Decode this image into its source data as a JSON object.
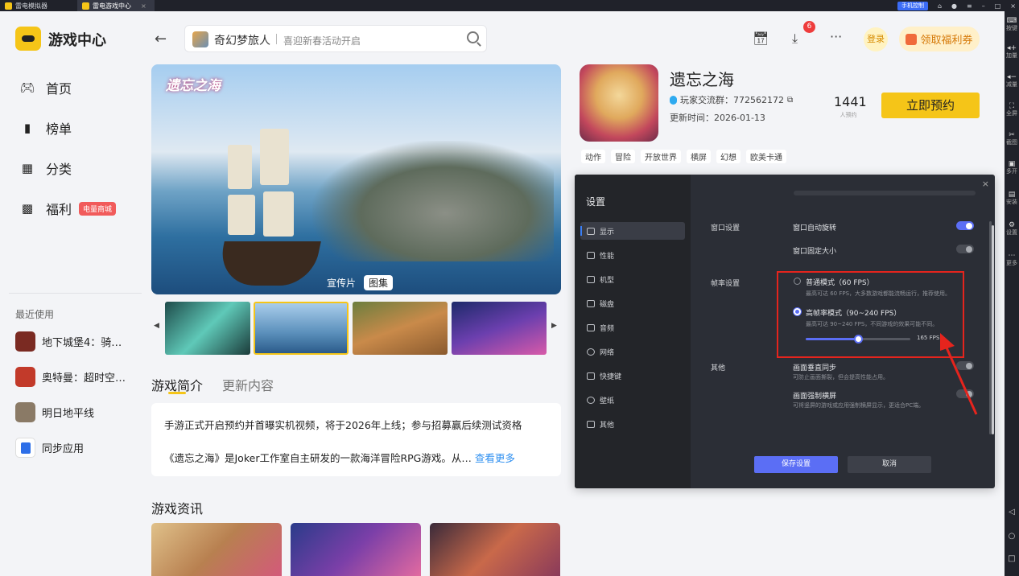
{
  "titlebar": {
    "tabs": [
      {
        "label": "雷电模拟器"
      },
      {
        "label": "雷电游戏中心"
      }
    ],
    "close_tab": "×",
    "phone_control": "手机控制",
    "window_buttons": {
      "minimize": "–",
      "maximize": "□",
      "close": "×"
    }
  },
  "right_strip": {
    "items": [
      {
        "label": "按键",
        "icon": "keyboard-icon"
      },
      {
        "label": "加量",
        "icon": "volume-up-icon"
      },
      {
        "label": "减量",
        "icon": "volume-down-icon"
      },
      {
        "label": "全屏",
        "icon": "fullscreen-icon"
      },
      {
        "label": "截图",
        "icon": "scissors-icon"
      },
      {
        "label": "多开",
        "icon": "multi-instance-icon"
      },
      {
        "label": "安装",
        "icon": "install-icon"
      },
      {
        "label": "设置",
        "icon": "gear-icon"
      },
      {
        "label": "更多",
        "icon": "more-icon"
      }
    ]
  },
  "sidebar": {
    "title": "游戏中心",
    "nav": [
      {
        "label": "首页",
        "icon": "gamepad-icon"
      },
      {
        "label": "榜单",
        "icon": "bar-chart-icon"
      },
      {
        "label": "分类",
        "icon": "grid-icon"
      },
      {
        "label": "福利",
        "icon": "gift-icon",
        "badge": "电量商城"
      }
    ],
    "recent_title": "最近使用",
    "recent": [
      {
        "label": "地下城堡4：骑…",
        "color": "#7a2a22"
      },
      {
        "label": "奥特曼：超时空…",
        "color": "#c23a2a"
      },
      {
        "label": "明日地平线",
        "color": "#8a7a66"
      },
      {
        "label": "同步应用",
        "color": "#2e6fe8"
      }
    ]
  },
  "header": {
    "search": {
      "keyword": "奇幻梦旅人",
      "placeholder": "喜迎新春活动开启"
    },
    "download_badge": "6",
    "more": "···",
    "login": "登录",
    "welfare": "领取福利券"
  },
  "banner": {
    "logo_text": "遗忘之海",
    "tabs": [
      "宣传片",
      "图集"
    ]
  },
  "content": {
    "tabs": [
      "游戏简介",
      "更新内容"
    ],
    "intro_line1": "手游正式开启预约并首曝实机视频，将于2026年上线；参与招募赢后续测试资格",
    "intro_line2": "《遗忘之海》是Joker工作室自主研发的一款海洋冒险RPG游戏。从…",
    "more_link": "查看更多",
    "news_title": "游戏资讯"
  },
  "game": {
    "name": "遗忘之海",
    "group": "玩家交流群：772562172",
    "update": "更新时间：2026-01-13",
    "reserve_count": "1441",
    "reserve_count_label": "人预约",
    "reserve_button": "立即预约",
    "tags": [
      "动作",
      "冒险",
      "开放世界",
      "横屏",
      "幻想",
      "欧美卡通"
    ]
  },
  "settings": {
    "title": "设置",
    "close": "×",
    "menu": [
      {
        "label": "显示",
        "active": true
      },
      {
        "label": "性能"
      },
      {
        "label": "机型"
      },
      {
        "label": "磁盘"
      },
      {
        "label": "音频"
      },
      {
        "label": "网络"
      },
      {
        "label": "快捷键"
      },
      {
        "label": "壁纸"
      },
      {
        "label": "其他"
      }
    ],
    "window_section": "窗口设置",
    "auto_rotate": {
      "label": "窗口自动旋转",
      "on": true
    },
    "fixed_size": {
      "label": "窗口固定大小",
      "on": false
    },
    "fps_section": "帧率设置",
    "normal_mode": {
      "label": "普通模式（60 FPS）",
      "desc": "最高可达 60 FPS，大多数游戏都能流畅运行，推荐使用。",
      "selected": false
    },
    "high_mode": {
      "label": "高帧率模式（90~240 FPS）",
      "desc": "最高可达 90~240 FPS，不同游戏的效果可能不同。",
      "selected": true
    },
    "fps_value": "165 FPS",
    "fps_slider": {
      "min": 90,
      "max": 240,
      "value": 165
    },
    "other_section": "其他",
    "vsync": {
      "label": "画面垂直同步",
      "desc": "可防止画面撕裂，但会提高性能占用。",
      "on": false
    },
    "force_landscape": {
      "label": "画面强制横屏",
      "desc": "可将竖屏的游戏或应用强制横屏显示，更适合PC端。",
      "on": false
    },
    "save": "保存设置",
    "cancel": "取消"
  }
}
